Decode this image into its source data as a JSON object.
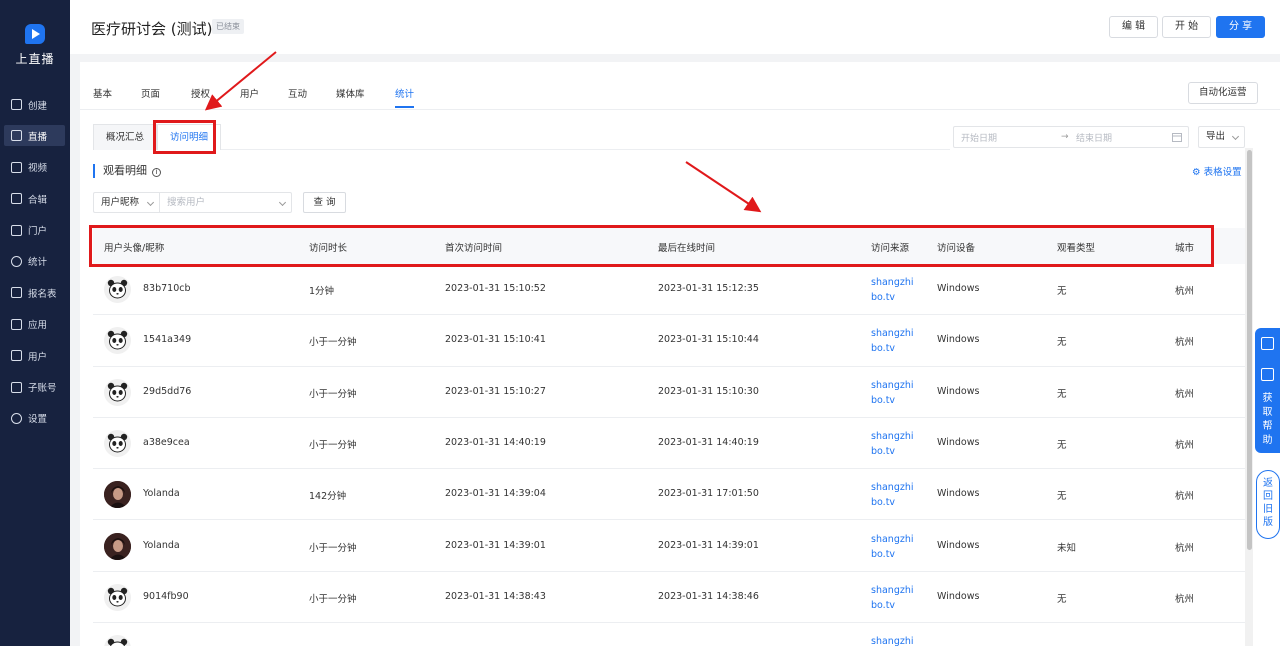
{
  "sidebar": {
    "logo_text": "上直播",
    "items": [
      {
        "label": "创建",
        "icon": "plus-square-icon"
      },
      {
        "label": "直播",
        "icon": "video-icon"
      },
      {
        "label": "视频",
        "icon": "film-icon"
      },
      {
        "label": "合辑",
        "icon": "collection-icon"
      },
      {
        "label": "门户",
        "icon": "monitor-icon"
      },
      {
        "label": "统计",
        "icon": "pie-chart-icon"
      },
      {
        "label": "报名表",
        "icon": "form-icon"
      },
      {
        "label": "应用",
        "icon": "grid-icon"
      },
      {
        "label": "用户",
        "icon": "user-icon"
      },
      {
        "label": "子账号",
        "icon": "sub-account-icon"
      },
      {
        "label": "设置",
        "icon": "gear-icon"
      }
    ],
    "active_index": 1
  },
  "header": {
    "title": "医疗研讨会 (测试)",
    "status": "已结束",
    "edit_label": "编 辑",
    "start_label": "开 始",
    "share_label": "分 享"
  },
  "tabs": {
    "items": [
      "基本",
      "页面",
      "授权",
      "用户",
      "互动",
      "媒体库",
      "统计"
    ],
    "active_index": 6,
    "automation_label": "自动化运营"
  },
  "subtabs": {
    "items": [
      "概况汇总",
      "访问明细"
    ],
    "active_index": 1
  },
  "date_filter": {
    "start_placeholder": "开始日期",
    "end_placeholder": "结束日期",
    "separator": "→"
  },
  "export_label": "导出",
  "section": {
    "title": "观看明细",
    "table_settings_label": "表格设置"
  },
  "filters": {
    "field_select": "用户昵称",
    "search_placeholder": "搜索用户",
    "query_label": "查 询"
  },
  "table": {
    "columns": [
      "用户头像/昵称",
      "访问时长",
      "首次访问时间",
      "最后在线时间",
      "访问来源",
      "访问设备",
      "观看类型",
      "城市"
    ],
    "rows": [
      {
        "nickname": "83b710cb",
        "avatar": "panda",
        "duration": "1分钟",
        "first_visit": "2023-01-31 15:10:52",
        "last_online": "2023-01-31 15:12:35",
        "source": "shangzhibo.tv",
        "device": "Windows",
        "watch_type": "无",
        "city": "杭州"
      },
      {
        "nickname": "1541a349",
        "avatar": "panda",
        "duration": "小于一分钟",
        "first_visit": "2023-01-31 15:10:41",
        "last_online": "2023-01-31 15:10:44",
        "source": "shangzhibo.tv",
        "device": "Windows",
        "watch_type": "无",
        "city": "杭州"
      },
      {
        "nickname": "29d5dd76",
        "avatar": "panda",
        "duration": "小于一分钟",
        "first_visit": "2023-01-31 15:10:27",
        "last_online": "2023-01-31 15:10:30",
        "source": "shangzhibo.tv",
        "device": "Windows",
        "watch_type": "无",
        "city": "杭州"
      },
      {
        "nickname": "a38e9cea",
        "avatar": "panda",
        "duration": "小于一分钟",
        "first_visit": "2023-01-31 14:40:19",
        "last_online": "2023-01-31 14:40:19",
        "source": "shangzhibo.tv",
        "device": "Windows",
        "watch_type": "无",
        "city": "杭州"
      },
      {
        "nickname": "Yolanda",
        "avatar": "photo",
        "duration": "142分钟",
        "first_visit": "2023-01-31 14:39:04",
        "last_online": "2023-01-31 17:01:50",
        "source": "shangzhibo.tv",
        "device": "Windows",
        "watch_type": "无",
        "city": "杭州"
      },
      {
        "nickname": "Yolanda",
        "avatar": "photo",
        "duration": "小于一分钟",
        "first_visit": "2023-01-31 14:39:01",
        "last_online": "2023-01-31 14:39:01",
        "source": "shangzhibo.tv",
        "device": "Windows",
        "watch_type": "未知",
        "city": "杭州"
      },
      {
        "nickname": "9014fb90",
        "avatar": "panda",
        "duration": "小于一分钟",
        "first_visit": "2023-01-31 14:38:43",
        "last_online": "2023-01-31 14:38:46",
        "source": "shangzhibo.tv",
        "device": "Windows",
        "watch_type": "无",
        "city": "杭州"
      },
      {
        "nickname": "",
        "avatar": "panda",
        "duration": "",
        "first_visit": "",
        "last_online": "",
        "source": "shangzhib",
        "device": "",
        "watch_type": "",
        "city": ""
      }
    ]
  },
  "float_help": {
    "help_label": "获取帮助",
    "back_label": "返回旧版"
  },
  "colors": {
    "sidebar_bg": "#17223f",
    "accent": "#1f74f0",
    "annotation_red": "#e0191b"
  }
}
